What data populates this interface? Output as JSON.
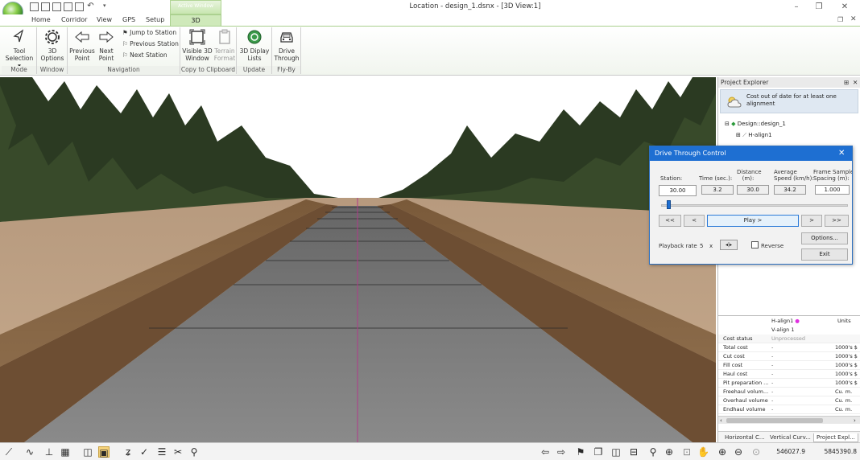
{
  "window": {
    "title": "Location - design_1.dsnx - [3D View:1]",
    "minimize": "–",
    "restore": "❐",
    "close": "✕"
  },
  "tabs": [
    {
      "label": "Home"
    },
    {
      "label": "Corridor"
    },
    {
      "label": "View"
    },
    {
      "label": "GPS"
    },
    {
      "label": "Setup"
    },
    {
      "label": "3D"
    }
  ],
  "context_tab_label": "Active Window",
  "ribbon": {
    "groups": [
      {
        "label": "Mode"
      },
      {
        "label": "Window"
      },
      {
        "label": "Navigation"
      },
      {
        "label": "Copy to Clipboard"
      },
      {
        "label": "Update"
      },
      {
        "label": "Fly-By"
      }
    ],
    "tool_selection": "Tool\nSelection",
    "tool_selection_l1": "Tool",
    "tool_selection_l2": "Selection",
    "options_l1": "3D",
    "options_l2": "Options",
    "prev_point_l1": "Previous",
    "prev_point_l2": "Point",
    "next_point_l1": "Next",
    "next_point_l2": "Point",
    "jump_station": "Jump to Station",
    "prev_station": "Previous Station",
    "next_station": "Next Station",
    "visible_3d_l1": "Visible 3D",
    "visible_3d_l2": "Window",
    "terrain_l1": "Terrain",
    "terrain_l2": "Format",
    "display_lists_l1": "3D Diplay",
    "display_lists_l2": "Lists",
    "drive_l1": "Drive",
    "drive_l2": "Through"
  },
  "explorer": {
    "title": "Project Explorer",
    "warning": "Cost out of date for at least one alignment",
    "tree": [
      {
        "label": "Design::design_1"
      },
      {
        "label": "H-align1"
      }
    ],
    "props": {
      "col1": "H-align1",
      "col2": "V-align 1",
      "units_header": "Units",
      "rows": [
        {
          "key": "Cost status",
          "value": "Unprocessed",
          "unit": ""
        },
        {
          "key": "Total cost",
          "value": "-",
          "unit": "1000's $"
        },
        {
          "key": "Cut cost",
          "value": "-",
          "unit": "1000's $"
        },
        {
          "key": "Fill cost",
          "value": "-",
          "unit": "1000's $"
        },
        {
          "key": "Haul cost",
          "value": "-",
          "unit": "1000's $"
        },
        {
          "key": "Pit preparation ...",
          "value": "-",
          "unit": "1000's $"
        },
        {
          "key": "Freehaul volum...",
          "value": "-",
          "unit": "Cu. m."
        },
        {
          "key": "Overhaul volume",
          "value": "-",
          "unit": "Cu. m."
        },
        {
          "key": "Endhaul volume",
          "value": "-",
          "unit": "Cu. m."
        }
      ]
    },
    "bottom_tabs": [
      {
        "label": "Horizontal C..."
      },
      {
        "label": "Vertical Curv..."
      },
      {
        "label": "Project Expl..."
      }
    ]
  },
  "dialog": {
    "title": "Drive Through Control",
    "close": "✕",
    "station_label": "Station:",
    "station_value": "30.00",
    "time_label": "Time (sec.):",
    "time_value": "3.2",
    "distance_label_l1": "Distance",
    "distance_label_l2": "(m):",
    "distance_value": "30.0",
    "speed_label_l1": "Average",
    "speed_label_l2": "Speed (km/h):",
    "speed_value": "34.2",
    "spacing_label_l1": "Frame Sample",
    "spacing_label_l2": "Spacing (m):",
    "spacing_value": "1.000",
    "slider_fraction": 0.03,
    "btn_first": "<<",
    "btn_prev": "<",
    "btn_play": "Play >",
    "btn_next": ">",
    "btn_last": ">>",
    "options": "Options...",
    "playback_label": "Playback rate",
    "playback_value": "5",
    "playback_unit": "x",
    "reverse_label": "Reverse",
    "exit": "Exit"
  },
  "status": {
    "easting": "546027.9",
    "northing": "5845390.8"
  },
  "colors": {
    "accent_tab": "#cfe9ba",
    "dialog_header": "#1e6fd2",
    "alignment_marker": "#e030e0"
  }
}
